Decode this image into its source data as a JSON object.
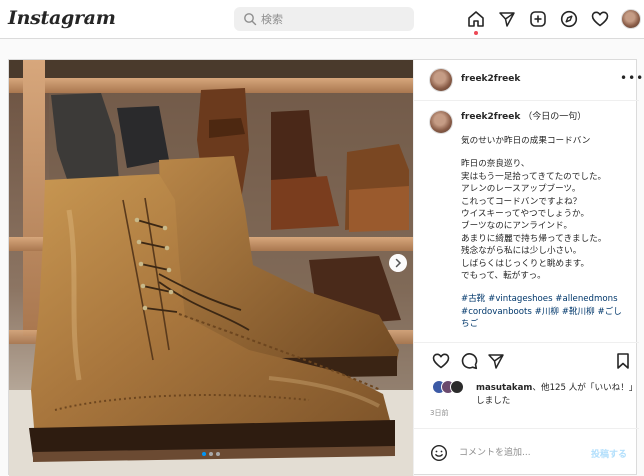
{
  "header": {
    "logo": "Instagram",
    "search_placeholder": "検索"
  },
  "icons": {
    "home": "home-icon",
    "direct": "paper-plane-icon",
    "new_post": "plus-square-icon",
    "explore": "compass-icon",
    "activity": "heart-icon",
    "profile": "avatar"
  },
  "post": {
    "username": "freek2freek",
    "caption_title": "（今日の一句）",
    "caption_lines": [
      "気のせいか昨日の成果コードバン",
      "",
      "昨日の奈良巡り、",
      "実はもう一足拾ってきてたのでした。",
      "アレンのレースアップブーツ。",
      "これってコードバンですよね？",
      "ウイスキーってやつでしょうか。",
      "ブーツなのにアンラインド。",
      "あまりに綺麗で持ち帰ってきました。",
      "残念ながら私には少し小さい。",
      "しばらくはじっくりと眺めます。",
      "でもって、転がすっ。",
      ""
    ],
    "hashtags": "#古靴 #vintageshoes #allenedmons #cordovanboots #川柳 #靴川柳 #ごしちご",
    "likes_prefix": "masutakam",
    "likes_suffix": "、他125 人が「いいね！」しました",
    "date": "3日前",
    "comment_placeholder": "コメントを追加...",
    "post_button": "投稿する",
    "carousel_count": 3,
    "carousel_active": 0
  },
  "colors": {
    "accent_blue": "#0095f6",
    "post_button_disabled": "#b2dffc",
    "hashtag": "#00376b",
    "notification_dot": "#ed4956"
  }
}
